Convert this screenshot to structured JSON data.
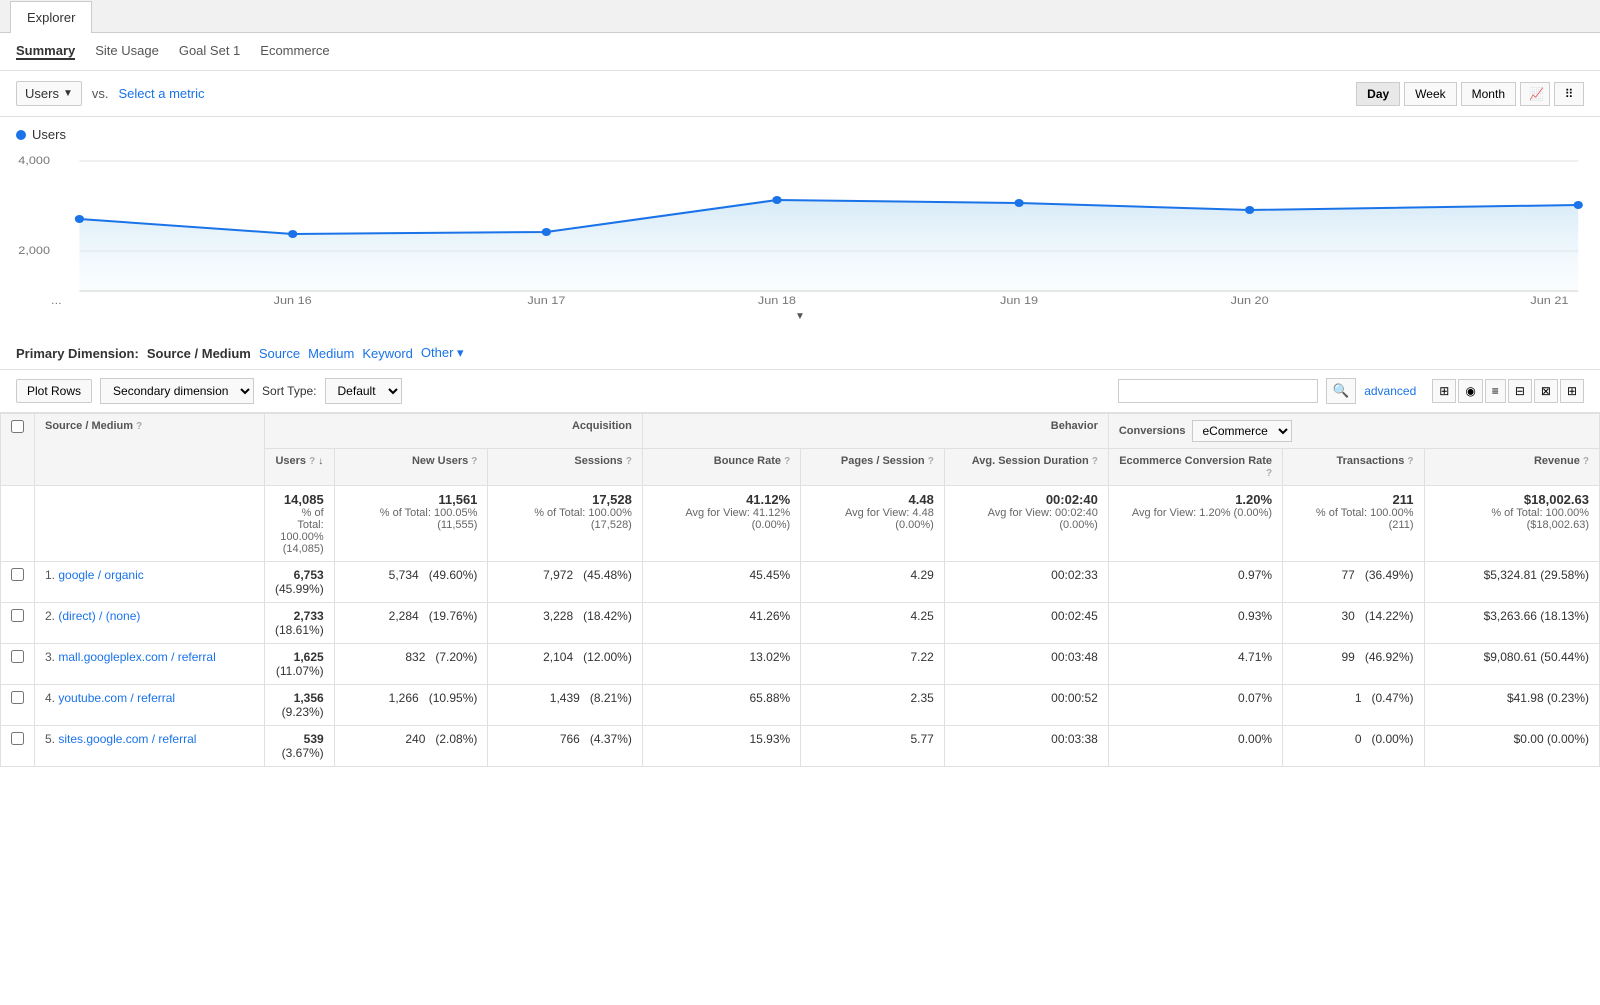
{
  "tabs": {
    "explorer": "Explorer"
  },
  "subTabs": [
    "Summary",
    "Site Usage",
    "Goal Set 1",
    "Ecommerce"
  ],
  "activeSubTab": "Summary",
  "metricBar": {
    "primaryMetric": "Users",
    "vs": "vs.",
    "selectMetric": "Select a metric",
    "dayButtons": [
      "Day",
      "Week",
      "Month"
    ]
  },
  "chart": {
    "legend": "Users",
    "yLabels": [
      "4,000",
      "2,000"
    ],
    "xLabels": [
      "...",
      "Jun 16",
      "Jun 17",
      "Jun 18",
      "Jun 19",
      "Jun 20",
      "Jun 21"
    ]
  },
  "primaryDimension": {
    "label": "Primary Dimension:",
    "active": "Source / Medium",
    "options": [
      "Source",
      "Medium",
      "Keyword",
      "Other ▾"
    ]
  },
  "tableControls": {
    "plotRows": "Plot Rows",
    "secondaryDimension": "Secondary dimension",
    "sortType": "Sort Type:",
    "sortDefault": "Default",
    "searchPlaceholder": "",
    "advanced": "advanced"
  },
  "tableHeaders": {
    "checkbox": "",
    "sourcemedium": "Source / Medium",
    "acquisitionGroup": "Acquisition",
    "behaviorGroup": "Behavior",
    "conversionsGroup": "Conversions",
    "ecommerceDropdown": "eCommerce",
    "users": "Users",
    "newUsers": "New Users",
    "sessions": "Sessions",
    "bounceRate": "Bounce Rate",
    "pagesPerSession": "Pages / Session",
    "avgSessionDuration": "Avg. Session Duration",
    "ecommerceConversionRate": "Ecommerce Conversion Rate",
    "transactions": "Transactions",
    "revenue": "Revenue"
  },
  "totals": {
    "users": "14,085",
    "usersLabel": "% of Total: 100.00% (14,085)",
    "newUsers": "11,561",
    "newUsersLabel": "% of Total: 100.05% (11,555)",
    "sessions": "17,528",
    "sessionsLabel": "% of Total: 100.00% (17,528)",
    "bounceRate": "41.12%",
    "bounceRateLabel": "Avg for View: 41.12% (0.00%)",
    "pagesPerSession": "4.48",
    "pagesPerSessionLabel": "Avg for View: 4.48 (0.00%)",
    "avgSessionDuration": "00:02:40",
    "avgSessionDurationLabel": "Avg for View: 00:02:40 (0.00%)",
    "ecommerceRate": "1.20%",
    "ecommerceRateLabel": "Avg for View: 1.20% (0.00%)",
    "transactions": "211",
    "transactionsLabel": "% of Total: 100.00% (211)",
    "revenue": "$18,002.63",
    "revenueLabel": "% of Total: 100.00% ($18,002.63)"
  },
  "rows": [
    {
      "num": "1.",
      "source": "google / organic",
      "users": "6,753",
      "usersPct": "(45.99%)",
      "newUsers": "5,734",
      "newUsersPct": "(49.60%)",
      "sessions": "7,972",
      "sessionsPct": "(45.48%)",
      "bounceRate": "45.45%",
      "pages": "4.29",
      "avgDuration": "00:02:33",
      "ecomRate": "0.97%",
      "transactions": "77",
      "transactionsPct": "(36.49%)",
      "revenue": "$5,324.81",
      "revenuePct": "(29.58%)"
    },
    {
      "num": "2.",
      "source": "(direct) / (none)",
      "users": "2,733",
      "usersPct": "(18.61%)",
      "newUsers": "2,284",
      "newUsersPct": "(19.76%)",
      "sessions": "3,228",
      "sessionsPct": "(18.42%)",
      "bounceRate": "41.26%",
      "pages": "4.25",
      "avgDuration": "00:02:45",
      "ecomRate": "0.93%",
      "transactions": "30",
      "transactionsPct": "(14.22%)",
      "revenue": "$3,263.66",
      "revenuePct": "(18.13%)"
    },
    {
      "num": "3.",
      "source": "mall.googleplex.com / referral",
      "users": "1,625",
      "usersPct": "(11.07%)",
      "newUsers": "832",
      "newUsersPct": "(7.20%)",
      "sessions": "2,104",
      "sessionsPct": "(12.00%)",
      "bounceRate": "13.02%",
      "pages": "7.22",
      "avgDuration": "00:03:48",
      "ecomRate": "4.71%",
      "transactions": "99",
      "transactionsPct": "(46.92%)",
      "revenue": "$9,080.61",
      "revenuePct": "(50.44%)"
    },
    {
      "num": "4.",
      "source": "youtube.com / referral",
      "users": "1,356",
      "usersPct": "(9.23%)",
      "newUsers": "1,266",
      "newUsersPct": "(10.95%)",
      "sessions": "1,439",
      "sessionsPct": "(8.21%)",
      "bounceRate": "65.88%",
      "pages": "2.35",
      "avgDuration": "00:00:52",
      "ecomRate": "0.07%",
      "transactions": "1",
      "transactionsPct": "(0.47%)",
      "revenue": "$41.98",
      "revenuePct": "(0.23%)"
    },
    {
      "num": "5.",
      "source": "sites.google.com / referral",
      "users": "539",
      "usersPct": "(3.67%)",
      "newUsers": "240",
      "newUsersPct": "(2.08%)",
      "sessions": "766",
      "sessionsPct": "(4.37%)",
      "bounceRate": "15.93%",
      "pages": "5.77",
      "avgDuration": "00:03:38",
      "ecomRate": "0.00%",
      "transactions": "0",
      "transactionsPct": "(0.00%)",
      "revenue": "$0.00",
      "revenuePct": "(0.00%)"
    }
  ]
}
